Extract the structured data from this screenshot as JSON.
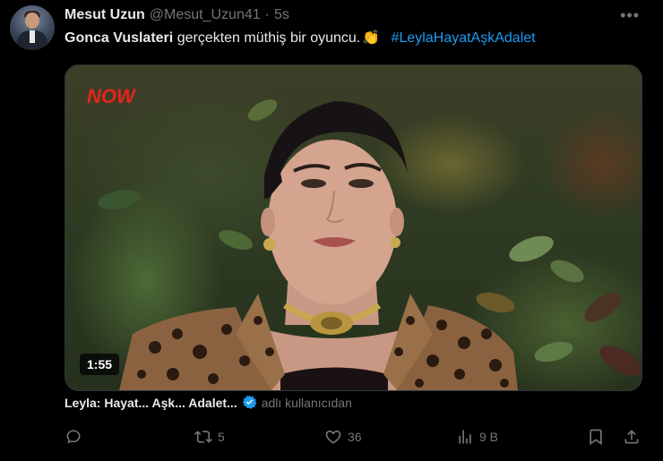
{
  "author": {
    "name": "Mesut Uzun",
    "handle": "@Mesut_Uzun41",
    "separator": "·",
    "time": "5s"
  },
  "more_label": "•••",
  "tweet": {
    "text_bold": "Gonca Vuslateri",
    "text_rest": "gerçekten müthiş bir oyuncu.",
    "emoji": "👏",
    "hashtag": "#LeylaHayatAşkAdalet"
  },
  "media": {
    "badge": "NOW",
    "duration": "1:55"
  },
  "source": {
    "title": "Leyla: Hayat... Aşk... Adalet...",
    "by": "adlı kullanıcıdan"
  },
  "actions": {
    "replies": "",
    "retweets": "5",
    "likes": "36",
    "views": "9 B"
  },
  "colors": {
    "background": "#000000",
    "text": "#e7e9ea",
    "muted": "#71767b",
    "link": "#1d9bf0",
    "badge": "#e8231c"
  }
}
